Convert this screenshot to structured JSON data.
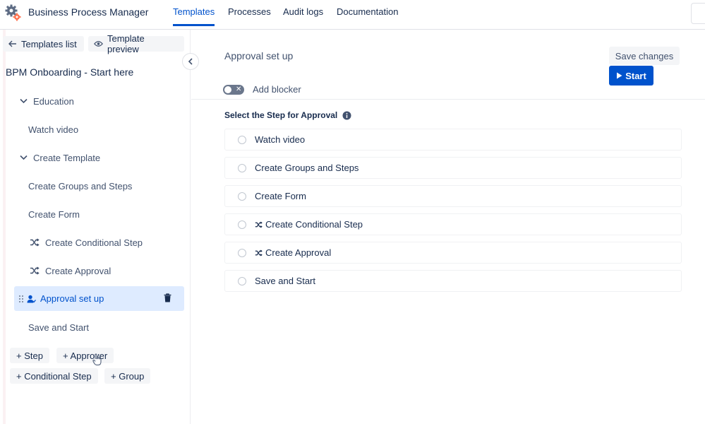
{
  "header": {
    "app_title": "Business Process Manager",
    "tabs": [
      {
        "label": "Templates",
        "active": true
      },
      {
        "label": "Processes",
        "active": false
      },
      {
        "label": "Audit logs",
        "active": false
      },
      {
        "label": "Documentation",
        "active": false
      }
    ]
  },
  "sidebar": {
    "templates_list_label": "Templates list",
    "template_preview_label": "Template preview",
    "template_name": "BPM Onboarding - Start here",
    "tree": [
      {
        "label": "Education",
        "kind": "group"
      },
      {
        "label": "Watch video",
        "kind": "step"
      },
      {
        "label": "Create Template",
        "kind": "group"
      },
      {
        "label": "Create Groups and Steps",
        "kind": "step"
      },
      {
        "label": "Create Form",
        "kind": "step"
      },
      {
        "label": "Create Conditional Step",
        "kind": "conditional"
      },
      {
        "label": "Create Approval",
        "kind": "conditional"
      },
      {
        "label": "Approval set up",
        "kind": "approver",
        "selected": true
      },
      {
        "label": "Save and Start",
        "kind": "step"
      }
    ],
    "add_buttons": {
      "step": "+ Step",
      "approver": "+ Approver",
      "conditional_step": "+ Conditional Step",
      "group": "+ Group"
    }
  },
  "main": {
    "title": "Approval set up",
    "save_label": "Save changes",
    "start_label": "Start",
    "blocker_label": "Add blocker",
    "blocker_enabled": false,
    "section_label": "Select the Step for Approval",
    "options": [
      {
        "label": "Watch video",
        "conditional": false
      },
      {
        "label": "Create Groups and Steps",
        "conditional": false
      },
      {
        "label": "Create Form",
        "conditional": false
      },
      {
        "label": "Create Conditional Step",
        "conditional": true
      },
      {
        "label": "Create Approval",
        "conditional": true
      },
      {
        "label": "Save and Start",
        "conditional": false
      }
    ]
  },
  "colors": {
    "accent": "#0052cc",
    "selected_bg": "#deebff",
    "chip_bg": "#f4f5f7"
  }
}
